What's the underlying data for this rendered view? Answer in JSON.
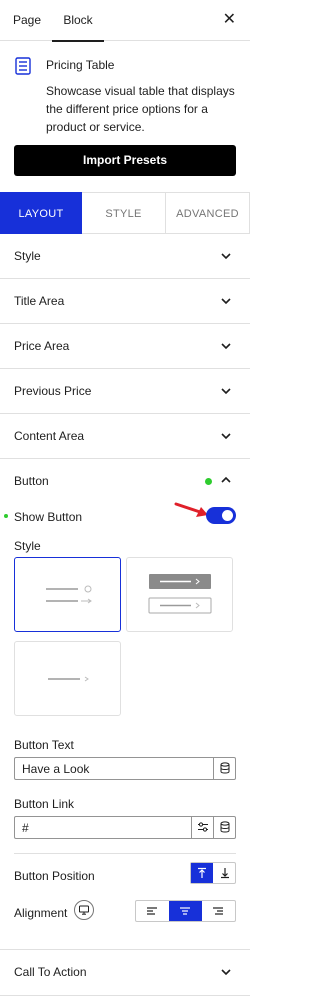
{
  "tabs": {
    "page": "Page",
    "block": "Block"
  },
  "block": {
    "title": "Pricing Table",
    "description": "Showcase visual table that displays the different price options for a product or service.",
    "import_button": "Import Presets"
  },
  "segments": {
    "layout": "LAYOUT",
    "style": "STYLE",
    "advanced": "ADVANCED",
    "active": "LAYOUT"
  },
  "panels": [
    {
      "label": "Style"
    },
    {
      "label": "Title Area"
    },
    {
      "label": "Price Area"
    },
    {
      "label": "Previous Price"
    },
    {
      "label": "Content Area"
    }
  ],
  "button_section": {
    "title": "Button",
    "show_button": {
      "label": "Show Button",
      "enabled": true
    },
    "style_label": "Style",
    "style_options": [
      "style-1",
      "style-2",
      "style-3"
    ],
    "selected_style": "style-1",
    "button_text": {
      "label": "Button Text",
      "value": "Have a Look"
    },
    "button_link": {
      "label": "Button Link",
      "value": "#"
    },
    "button_position": {
      "label": "Button Position",
      "selected": "top"
    },
    "alignment": {
      "label": "Alignment",
      "selected": "center"
    }
  },
  "call_to_action": {
    "label": "Call To Action"
  },
  "colors": {
    "accent": "#1730d9",
    "active_dot": "#2ecc2e",
    "pointer_arrow": "#e0202a"
  }
}
